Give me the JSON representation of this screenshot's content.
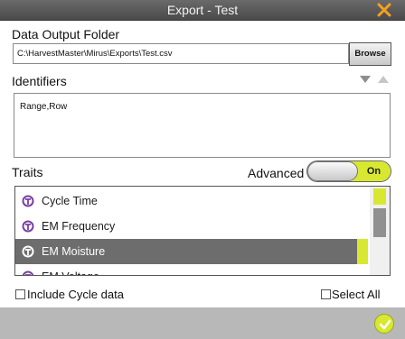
{
  "window": {
    "title": "Export - Test"
  },
  "output": {
    "label": "Data Output Folder",
    "path": "C:\\HarvestMaster\\Mirus\\Exports\\Test.csv",
    "browse_label": "Browse"
  },
  "identifiers": {
    "label": "Identifiers",
    "value": "Range,Row"
  },
  "traits": {
    "label": "Traits",
    "advanced_label": "Advanced",
    "toggle_label": "On",
    "items": [
      {
        "name": "Cycle Time"
      },
      {
        "name": "EM Frequency"
      },
      {
        "name": "EM Moisture"
      },
      {
        "name": "EM Voltage"
      }
    ]
  },
  "options": {
    "include_cycle_label": "Include Cycle data",
    "select_all_label": "Select All"
  },
  "colors": {
    "accent": "#d8e830",
    "titlebar": "#555555",
    "selected_row": "#6d6d6d",
    "close": "#f5a020"
  }
}
